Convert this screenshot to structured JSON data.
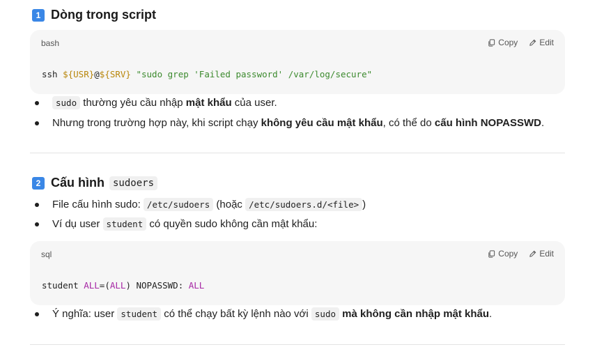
{
  "section1": {
    "number": "1",
    "title": "Dòng trong script",
    "code": {
      "lang": "bash",
      "copy_label": "Copy",
      "edit_label": "Edit",
      "line": {
        "p1": "ssh ",
        "p2": "${USR}",
        "p3": "@",
        "p4": "${SRV}",
        "p5": " ",
        "p6": "\"sudo grep 'Failed password' /var/log/secure\""
      }
    },
    "bullets": [
      {
        "code": "sudo",
        "t1": " thường yêu cầu nhập ",
        "b1": "mật khẩu",
        "t2": " của user."
      },
      {
        "t1": "Nhưng trong trường hợp này, khi script chạy ",
        "b1": "không yêu cầu mật khẩu",
        "t2": ", có thể do ",
        "b2": "cấu hình NOPASSWD",
        "t3": "."
      }
    ]
  },
  "section2": {
    "number": "2",
    "title": "Cấu hình",
    "title_code": "sudoers",
    "bullets": [
      {
        "t1": "File cấu hình sudo: ",
        "c1": "/etc/sudoers",
        "t2": " (hoặc ",
        "c2": "/etc/sudoers.d/<file>",
        "t3": ")"
      },
      {
        "t1": "Ví dụ user ",
        "c1": "student",
        "t2": " có quyền sudo không cần mật khẩu:"
      }
    ],
    "code": {
      "lang": "sql",
      "copy_label": "Copy",
      "edit_label": "Edit",
      "line": {
        "p1": "student ",
        "p2": "ALL",
        "p3": "=(",
        "p4": "ALL",
        "p5": ") NOPASSWD: ",
        "p6": "ALL"
      }
    },
    "bullet3": {
      "t1": "Ý nghĩa: user ",
      "c1": "student",
      "t2": " có thể chạy bất kỳ lệnh nào với ",
      "c2": "sudo",
      "t3": " ",
      "b1": "mà không cần nhập mật khẩu",
      "t4": "."
    }
  },
  "colors": {
    "badge": "#3a87e6",
    "code_bg": "#f6f6f6",
    "token_variable": "#b8860b",
    "token_string": "#3c8a2e",
    "token_keyword": "#a626a4"
  },
  "icons": {
    "copy": "copy-icon",
    "edit": "edit-pencil-icon"
  }
}
